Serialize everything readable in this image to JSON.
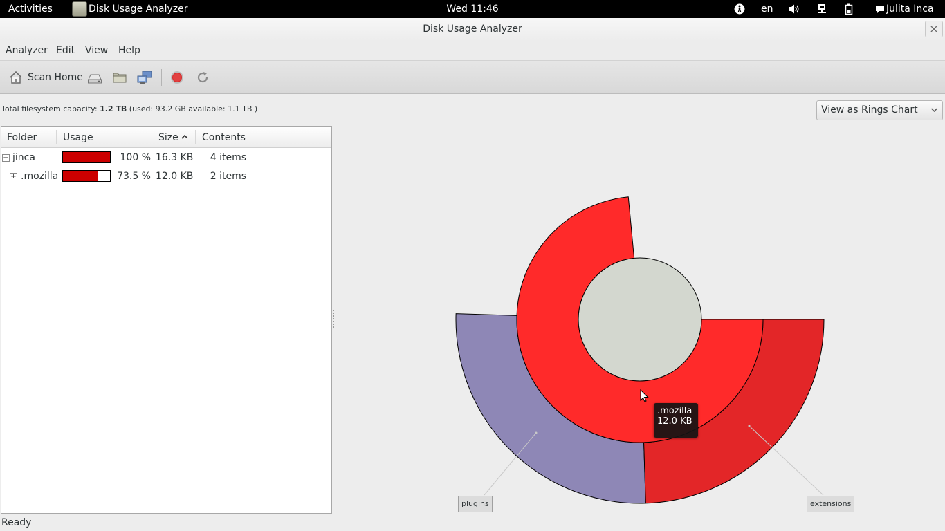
{
  "top_panel": {
    "activities": "Activities",
    "app_name": "Disk Usage Analyzer",
    "clock": "Wed 11:46",
    "language": "en",
    "user": "Julita Inca"
  },
  "window": {
    "title": "Disk Usage Analyzer",
    "close": "×"
  },
  "menubar": [
    "Analyzer",
    "Edit",
    "View",
    "Help"
  ],
  "toolbar": {
    "scan_home_label": "Scan Home",
    "icons": [
      "home-icon",
      "scan-filesystem-icon",
      "scan-folder-icon",
      "scan-remote-icon",
      "stop-icon",
      "refresh-icon"
    ]
  },
  "capacity": {
    "prefix": "Total filesystem capacity:",
    "total": "1.2 TB",
    "details": "(used: 93.2 GB available: 1.1 TB )"
  },
  "view_select": {
    "value": "View as Rings Chart"
  },
  "tree": {
    "headers": {
      "folder": "Folder",
      "usage": "Usage",
      "size": "Size",
      "contents": "Contents"
    },
    "sort_indicator": "^",
    "rows": [
      {
        "expander": "−",
        "name": "jinca",
        "usage_fraction": 1.0,
        "percent": "100 %",
        "size": "16.3 KB",
        "contents": "4 items"
      },
      {
        "expander": "+",
        "name": ".mozilla",
        "usage_fraction": 0.735,
        "percent": "73.5 %",
        "size": "12.0 KB",
        "contents": "2 items"
      }
    ]
  },
  "chart": {
    "center_color": "#d3d7cf",
    "colors": {
      "mozilla": "#ff2a2a",
      "extensions": "#e32628",
      "plugins": "#8e87b6"
    },
    "rings": [
      {
        "name": ".mozilla",
        "level": 1,
        "start_fraction": 0.0,
        "fraction": 0.735
      },
      {
        "name": "extensions",
        "level": 2,
        "start_fraction": 0.0,
        "fraction": 0.245
      },
      {
        "name": "plugins",
        "level": 2,
        "start_fraction": 0.245,
        "fraction": 0.26
      }
    ],
    "labels": {
      "plugins": "plugins",
      "extensions": "extensions"
    },
    "tooltip": {
      "name": ".mozilla",
      "size": "12.0 KB"
    }
  },
  "status": "Ready"
}
